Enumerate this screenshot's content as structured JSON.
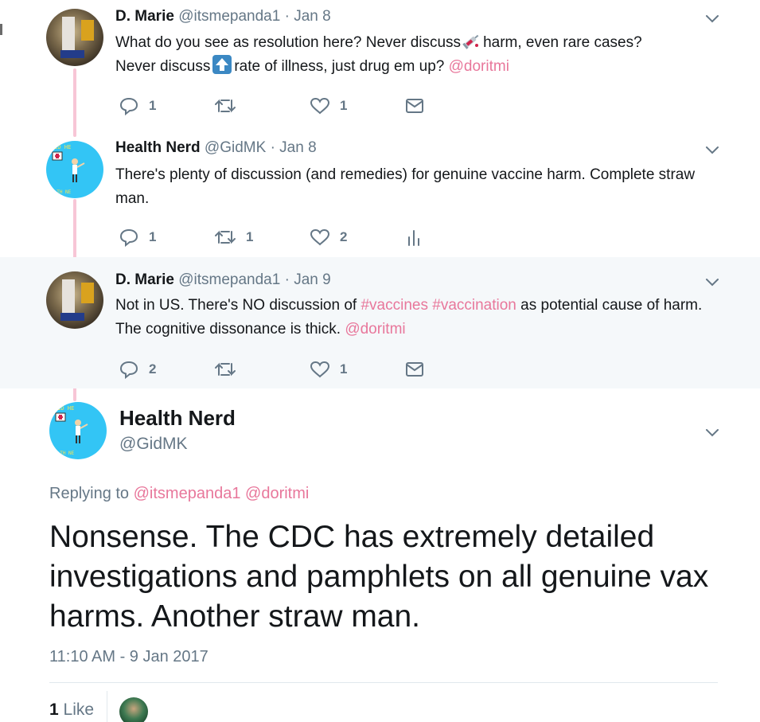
{
  "tweets": [
    {
      "name": "D. Marie",
      "handle": "@itsmepanda1",
      "date": "Jan 8",
      "text_parts": [
        "What do you see as resolution here? Never discuss",
        "harm, even rare cases?",
        "Never discuss",
        "rate of illness, just drug em up?"
      ],
      "mention": "@doritmi",
      "emojis": [
        "syringe-icon",
        "up-arrow-icon"
      ],
      "actions": {
        "replies": "1",
        "retweets": "",
        "likes": "1"
      }
    },
    {
      "name": "Health Nerd",
      "handle": "@GidMK",
      "date": "Jan 8",
      "text": "There's plenty of discussion (and remedies) for genuine vaccine harm. Complete straw man.",
      "actions": {
        "replies": "1",
        "retweets": "1",
        "likes": "2"
      }
    },
    {
      "name": "D. Marie",
      "handle": "@itsmepanda1",
      "date": "Jan 9",
      "text_before": "Not in US. There's NO discussion of",
      "hashtags": [
        "#vaccines",
        "#vaccination"
      ],
      "text_after": "as potential cause of harm. The cognitive dissonance is thick.",
      "mention": "@doritmi",
      "actions": {
        "replies": "2",
        "retweets": "",
        "likes": "1"
      }
    }
  ],
  "main_tweet": {
    "name": "Health Nerd",
    "handle": "@GidMK",
    "replying_label": "Replying to",
    "replying_to": [
      "@itsmepanda1",
      "@doritmi"
    ],
    "text": "Nonsense. The CDC has extremely detailed investigations and pamphlets on all genuine vax harms. Another straw man.",
    "timestamp": "11:10 AM - 9 Jan 2017",
    "like_count": "1",
    "like_label": "Like"
  },
  "colors": {
    "link": "#e8779b",
    "thread_line": "#f7c6d6",
    "muted": "#657786",
    "highlight_bg": "#f5f8fa"
  }
}
